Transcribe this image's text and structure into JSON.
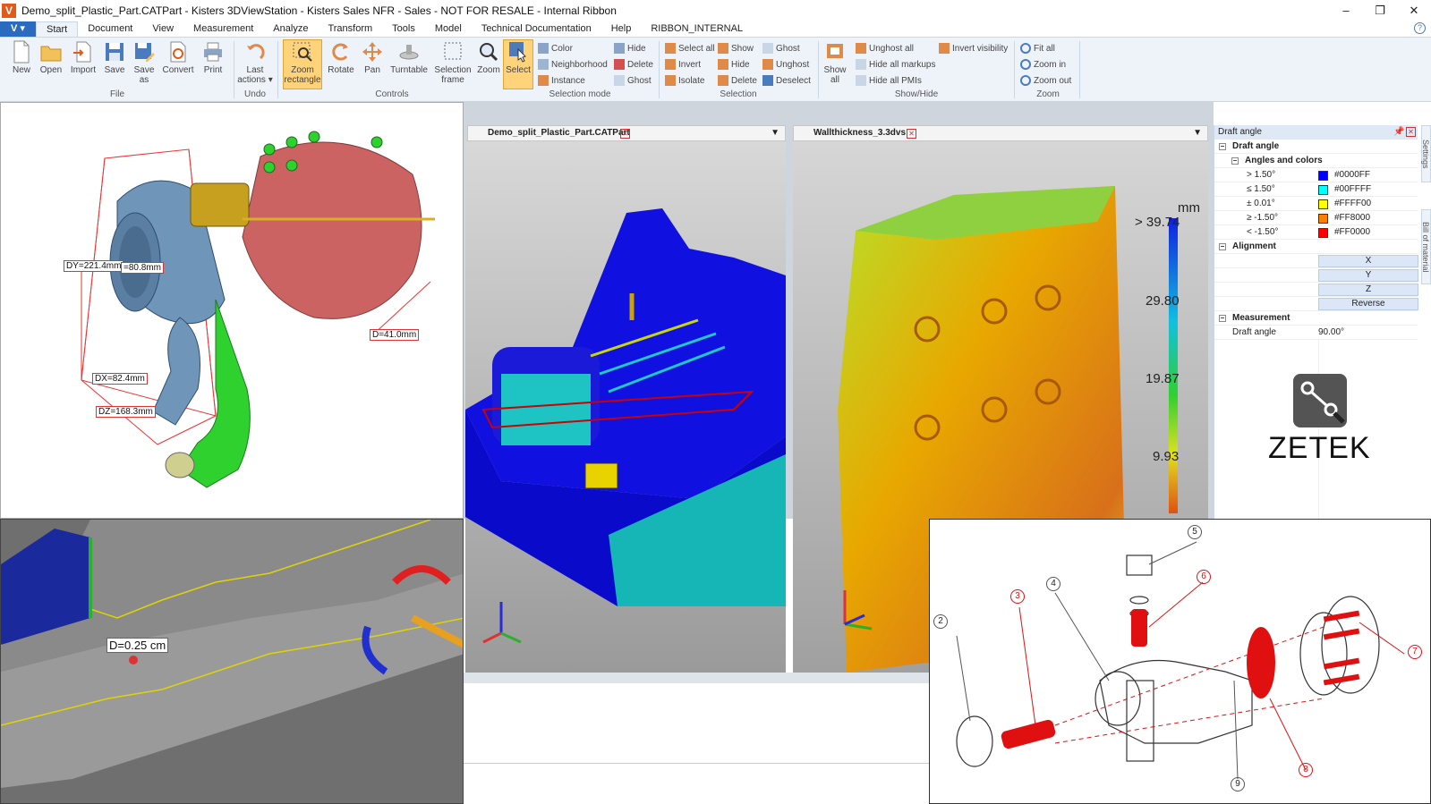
{
  "window": {
    "title": "Demo_split_Plastic_Part.CATPart - Kisters 3DViewStation - Kisters Sales NFR - Sales - NOT FOR RESALE - Internal Ribbon",
    "logo_letter": "V",
    "minimize": "–",
    "maximize": "❐",
    "close": "✕"
  },
  "ribbon_tabs": [
    "Start",
    "Document",
    "View",
    "Measurement",
    "Analyze",
    "Transform",
    "Tools",
    "Model",
    "Technical Documentation",
    "Help",
    "RIBBON_INTERNAL"
  ],
  "app_menu_label": "V",
  "help_label": "?",
  "file_group": {
    "label": "File",
    "buttons": [
      "New",
      "Open",
      "Import",
      "Save",
      "Save as",
      "Convert",
      "Print"
    ]
  },
  "undo_group": {
    "label": "Undo",
    "last_actions": "Last actions"
  },
  "controls_group": {
    "label": "Controls",
    "buttons": [
      "Zoom rectangle",
      "Rotate",
      "Pan",
      "Turntable",
      "Selection frame",
      "Zoom"
    ]
  },
  "selection_mode_group": {
    "label": "Selection mode",
    "select": "Select",
    "items": [
      "Color",
      "Neighborhood",
      "Instance"
    ]
  },
  "selection_group": {
    "label": "Selection",
    "col1": [
      "Hide",
      "Delete",
      "Ghost"
    ],
    "col2": [
      "Select all",
      "Invert",
      "Isolate"
    ],
    "col3": [
      "Show",
      "Hide",
      "Delete"
    ],
    "col4": [
      "Ghost",
      "Unghost",
      "Deselect"
    ]
  },
  "showhide_group": {
    "label": "Show/Hide",
    "show_all": "Show all",
    "items": [
      "Unghost all",
      "Hide all markups",
      "Hide all PMIs"
    ],
    "invert_visibility": "Invert visibility"
  },
  "zoom_group": {
    "label": "Zoom",
    "items": [
      "Fit all",
      "Zoom in",
      "Zoom out"
    ]
  },
  "doc_tabs": {
    "tab1": "Demo_split_Plastic_Part.CATPart",
    "tab2": "Wallthickness_3.3dvs"
  },
  "turbo_callouts": {
    "dy": "DY=221.4mm",
    "r": "=80.8mm",
    "d41": "D=41.0mm",
    "dx": "DX=82.4mm",
    "dz": "DZ=168.3mm"
  },
  "section_callout": "D=0.25 cm",
  "wall_legend": {
    "unit": "mm",
    "ticks": [
      "> 39.74",
      "29.80",
      "19.87",
      "9.93"
    ]
  },
  "properties": {
    "header": "Draft angle",
    "section_draft": "Draft angle",
    "section_angles": "Angles and colors",
    "angles": [
      {
        "label": "> 1.50°",
        "color": "#0000FF",
        "hex": "#0000FF"
      },
      {
        "label": "≤ 1.50°",
        "color": "#00FFFF",
        "hex": "#00FFFF"
      },
      {
        "label": "± 0.01°",
        "color": "#FFFF00",
        "hex": "#FFFF00"
      },
      {
        "label": "≥ -1.50°",
        "color": "#FF8000",
        "hex": "#FF8000"
      },
      {
        "label": "< -1.50°",
        "color": "#FF0000",
        "hex": "#FF0000"
      }
    ],
    "section_alignment": "Alignment",
    "alignment_buttons": [
      "X",
      "Y",
      "Z",
      "Reverse"
    ],
    "section_measurement": "Measurement",
    "measurement_key": "Draft angle",
    "measurement_value": "90.00°",
    "side_tab_settings": "Settings",
    "side_tab_bom": "Bill of material"
  },
  "brand_text": "ZETEK",
  "balloons": [
    "2",
    "3",
    "4",
    "5",
    "6",
    "7",
    "8",
    "9"
  ]
}
